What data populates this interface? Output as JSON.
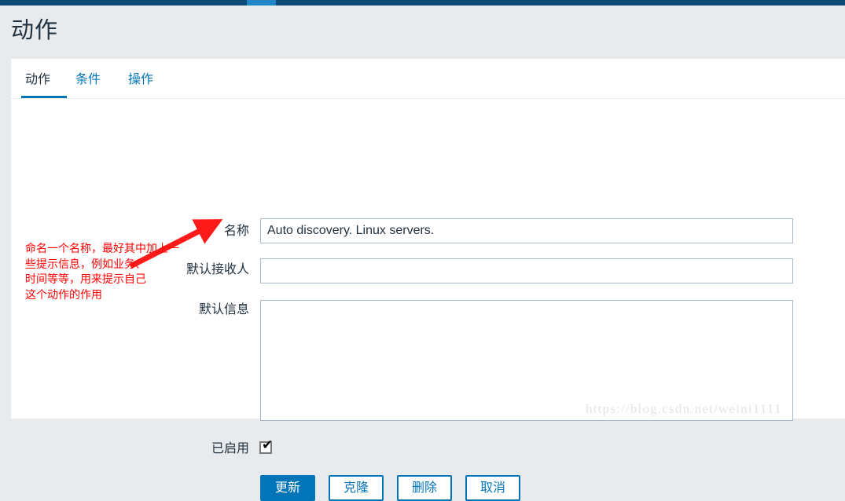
{
  "topbar": {
    "accent_color": "#0c4b76",
    "active_tab_color": "#1f87c8"
  },
  "header": {
    "title": "动作"
  },
  "tabs": [
    {
      "label": "动作",
      "active": true
    },
    {
      "label": "条件",
      "active": false
    },
    {
      "label": "操作",
      "active": false
    }
  ],
  "form": {
    "name": {
      "label": "名称",
      "value": "Auto discovery. Linux servers.",
      "placeholder": ""
    },
    "default_recipient": {
      "label": "默认接收人",
      "value": "",
      "placeholder": ""
    },
    "default_message": {
      "label": "默认信息",
      "value": "",
      "placeholder": ""
    },
    "enabled": {
      "label": "已启用",
      "checked": true,
      "tick": "✔"
    }
  },
  "buttons": [
    {
      "label": "更新",
      "primary": true
    },
    {
      "label": "克隆",
      "primary": false
    },
    {
      "label": "删除",
      "primary": false
    },
    {
      "label": "取消",
      "primary": false
    }
  ],
  "annotation": {
    "text": "命名一个名称，最好其中加上一\n些提示信息，例如业务、\n时间等等，用来提示自己\n这个动作的作用",
    "color": "#ff0000"
  },
  "watermark": {
    "text": "https://blog.csdn.net/weini1111"
  },
  "colors": {
    "accent": "#0275b8",
    "page_bg": "#e8ebee",
    "card_bg": "#ffffff",
    "text": "#23323f",
    "input_border": "#aab7c4"
  }
}
